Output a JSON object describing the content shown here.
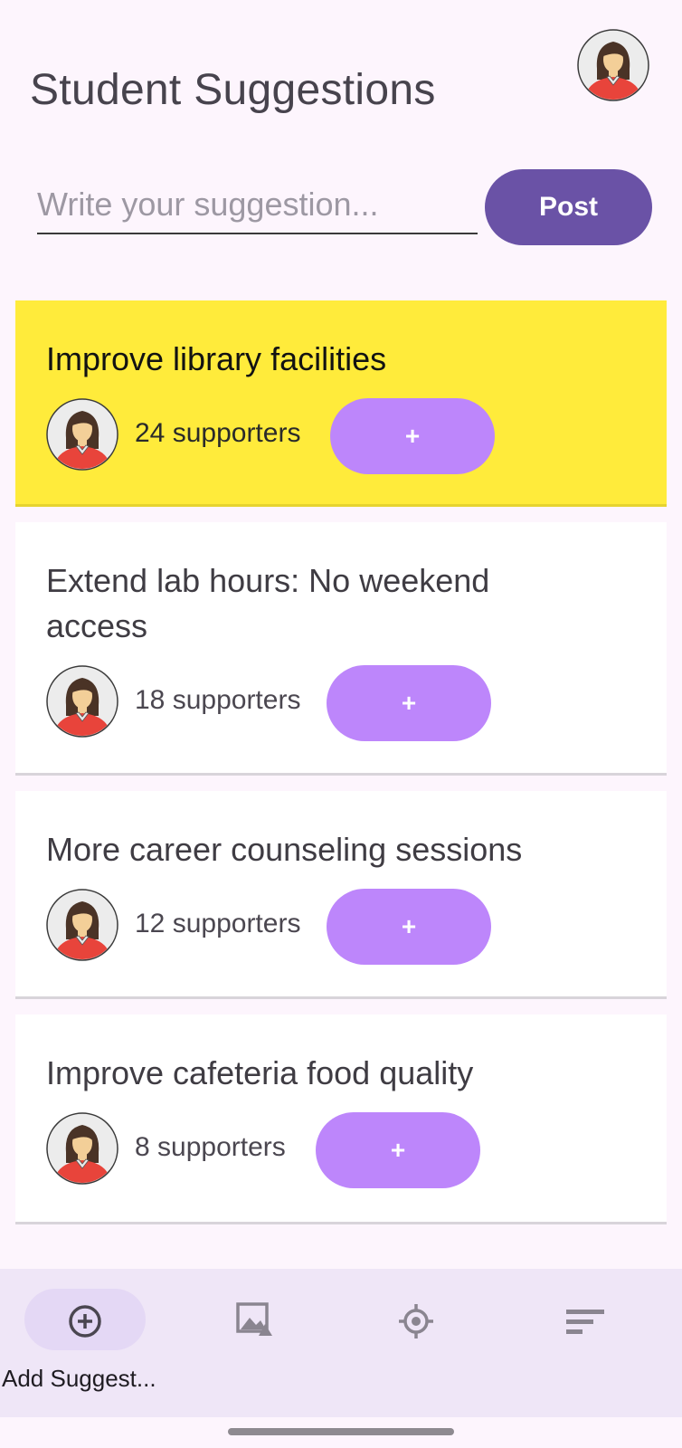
{
  "header": {
    "title": "Student Suggestions"
  },
  "composer": {
    "placeholder": "Write your suggestion...",
    "post_label": "Post"
  },
  "suggestions": [
    {
      "title": "Improve library facilities",
      "supporters": "24 supporters",
      "support_label": "+",
      "highlighted": true
    },
    {
      "title": "Extend lab hours: No weekend access",
      "supporters": "18 supporters",
      "support_label": "+",
      "highlighted": false
    },
    {
      "title": "More career counseling sessions",
      "supporters": "12 supporters",
      "support_label": "+",
      "highlighted": false
    },
    {
      "title": "Improve cafeteria food quality",
      "supporters": "8 supporters",
      "support_label": "+",
      "highlighted": false
    }
  ],
  "bottom_nav": {
    "items": [
      {
        "label": "Add Suggest...",
        "icon": "add-circle-icon",
        "selected": true
      },
      {
        "label": "",
        "icon": "gallery-icon",
        "selected": false
      },
      {
        "label": "",
        "icon": "target-icon",
        "selected": false
      },
      {
        "label": "",
        "icon": "sort-icon",
        "selected": false
      }
    ]
  },
  "colors": {
    "background": "#fdf5fd",
    "primary": "#6a52a6",
    "support_button": "#bd86fb",
    "highlight_card": "#ffeb3b",
    "nav_background": "#efe6f7"
  }
}
